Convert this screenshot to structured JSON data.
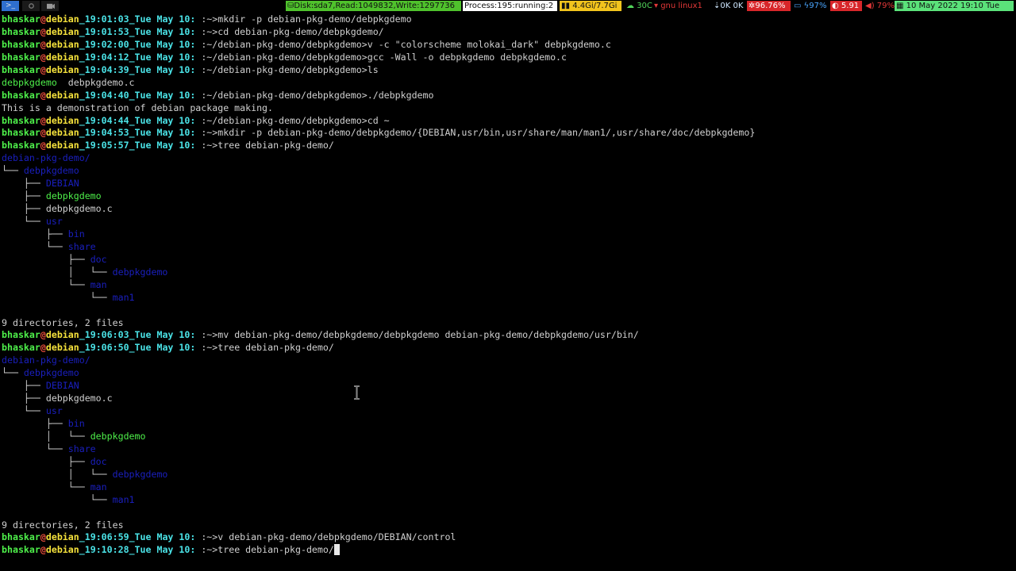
{
  "topbar": {
    "terminal_label": ">_",
    "disk": "Disk:sda7,Read:1049832,Write:1297736",
    "process": "Process:195:running:2",
    "memory": "4.4Gi/7.7Gi",
    "temp": "30C",
    "net_label": "gnu  linux1",
    "net_speed": "0K  0K",
    "cpu": "96.76%",
    "battery": "97%",
    "load": "5.91",
    "volume": "79%",
    "clock": "10 May 2022 19:10 Tue"
  },
  "terminal": {
    "user": "bhaskar",
    "host": "debian",
    "lines": [
      {
        "kind": "prompt",
        "ts": "_19:01:03_Tue May 10:",
        "path": " :~>",
        "cmd": "mkdir -p debian-pkg-demo/debpkgdemo"
      },
      {
        "kind": "prompt",
        "ts": "_19:01:53_Tue May 10:",
        "path": " :~>",
        "cmd": "cd debian-pkg-demo/debpkgdemo/"
      },
      {
        "kind": "prompt",
        "ts": "_19:02:00_Tue May 10:",
        "path": " :~/debian-pkg-demo/debpkgdemo>",
        "cmd": "v -c \"colorscheme molokai_dark\" debpkgdemo.c"
      },
      {
        "kind": "prompt",
        "ts": "_19:04:12_Tue May 10:",
        "path": " :~/debian-pkg-demo/debpkgdemo>",
        "cmd": "gcc -Wall -o debpkgdemo debpkgdemo.c"
      },
      {
        "kind": "prompt",
        "ts": "_19:04:39_Tue May 10:",
        "path": " :~/debian-pkg-demo/debpkgdemo>",
        "cmd": "ls"
      },
      {
        "kind": "ls",
        "exe": "debpkgdemo",
        "file": "  debpkgdemo.c"
      },
      {
        "kind": "prompt",
        "ts": "_19:04:40_Tue May 10:",
        "path": " :~/debian-pkg-demo/debpkgdemo>",
        "cmd": "./debpkgdemo"
      },
      {
        "kind": "out",
        "text": "This is a demonstration of debian package making."
      },
      {
        "kind": "prompt",
        "ts": "_19:04:44_Tue May 10:",
        "path": " :~/debian-pkg-demo/debpkgdemo>",
        "cmd": "cd ~"
      },
      {
        "kind": "prompt",
        "ts": "_19:04:53_Tue May 10:",
        "path": " :~>",
        "cmd": "mkdir -p debian-pkg-demo/debpkgdemo/{DEBIAN,usr/bin,usr/share/man/man1/,usr/share/doc/debpkgdemo}"
      },
      {
        "kind": "prompt",
        "ts": "_19:05:57_Tue May 10:",
        "path": " :~>",
        "cmd": "tree debian-pkg-demo/"
      },
      {
        "kind": "tree",
        "prefix": "",
        "name": "debian-pkg-demo/",
        "type": "dir"
      },
      {
        "kind": "tree",
        "prefix": "└── ",
        "name": "debpkgdemo",
        "type": "dir"
      },
      {
        "kind": "tree",
        "prefix": "    ├── ",
        "name": "DEBIAN",
        "type": "dir"
      },
      {
        "kind": "tree",
        "prefix": "    ├── ",
        "name": "debpkgdemo",
        "type": "exe"
      },
      {
        "kind": "tree",
        "prefix": "    ├── ",
        "name": "debpkgdemo.c",
        "type": "file"
      },
      {
        "kind": "tree",
        "prefix": "    └── ",
        "name": "usr",
        "type": "dir"
      },
      {
        "kind": "tree",
        "prefix": "        ├── ",
        "name": "bin",
        "type": "dir"
      },
      {
        "kind": "tree",
        "prefix": "        └── ",
        "name": "share",
        "type": "dir"
      },
      {
        "kind": "tree",
        "prefix": "            ├── ",
        "name": "doc",
        "type": "dir"
      },
      {
        "kind": "tree",
        "prefix": "            │   └── ",
        "name": "debpkgdemo",
        "type": "dir"
      },
      {
        "kind": "tree",
        "prefix": "            └── ",
        "name": "man",
        "type": "dir"
      },
      {
        "kind": "tree",
        "prefix": "                └── ",
        "name": "man1",
        "type": "dir"
      },
      {
        "kind": "out",
        "text": ""
      },
      {
        "kind": "out",
        "text": "9 directories, 2 files"
      },
      {
        "kind": "prompt",
        "ts": "_19:06:03_Tue May 10:",
        "path": " :~>",
        "cmd": "mv debian-pkg-demo/debpkgdemo/debpkgdemo debian-pkg-demo/debpkgdemo/usr/bin/"
      },
      {
        "kind": "prompt",
        "ts": "_19:06:50_Tue May 10:",
        "path": " :~>",
        "cmd": "tree debian-pkg-demo/"
      },
      {
        "kind": "tree",
        "prefix": "",
        "name": "debian-pkg-demo/",
        "type": "dir"
      },
      {
        "kind": "tree",
        "prefix": "└── ",
        "name": "debpkgdemo",
        "type": "dir"
      },
      {
        "kind": "tree",
        "prefix": "    ├── ",
        "name": "DEBIAN",
        "type": "dir"
      },
      {
        "kind": "tree",
        "prefix": "    ├── ",
        "name": "debpkgdemo.c",
        "type": "file"
      },
      {
        "kind": "tree",
        "prefix": "    └── ",
        "name": "usr",
        "type": "dir"
      },
      {
        "kind": "tree",
        "prefix": "        ├── ",
        "name": "bin",
        "type": "dir"
      },
      {
        "kind": "tree",
        "prefix": "        │   └── ",
        "name": "debpkgdemo",
        "type": "exe"
      },
      {
        "kind": "tree",
        "prefix": "        └── ",
        "name": "share",
        "type": "dir"
      },
      {
        "kind": "tree",
        "prefix": "            ├── ",
        "name": "doc",
        "type": "dir"
      },
      {
        "kind": "tree",
        "prefix": "            │   └── ",
        "name": "debpkgdemo",
        "type": "dir"
      },
      {
        "kind": "tree",
        "prefix": "            └── ",
        "name": "man",
        "type": "dir"
      },
      {
        "kind": "tree",
        "prefix": "                └── ",
        "name": "man1",
        "type": "dir"
      },
      {
        "kind": "out",
        "text": ""
      },
      {
        "kind": "out",
        "text": "9 directories, 2 files"
      },
      {
        "kind": "prompt",
        "ts": "_19:06:59_Tue May 10:",
        "path": " :~>",
        "cmd": "v debian-pkg-demo/debpkgdemo/DEBIAN/control"
      },
      {
        "kind": "prompt",
        "ts": "_19:10:28_Tue May 10:",
        "path": " :~>",
        "cmd": "tree debian-pkg-demo/",
        "cursor": true
      }
    ]
  }
}
